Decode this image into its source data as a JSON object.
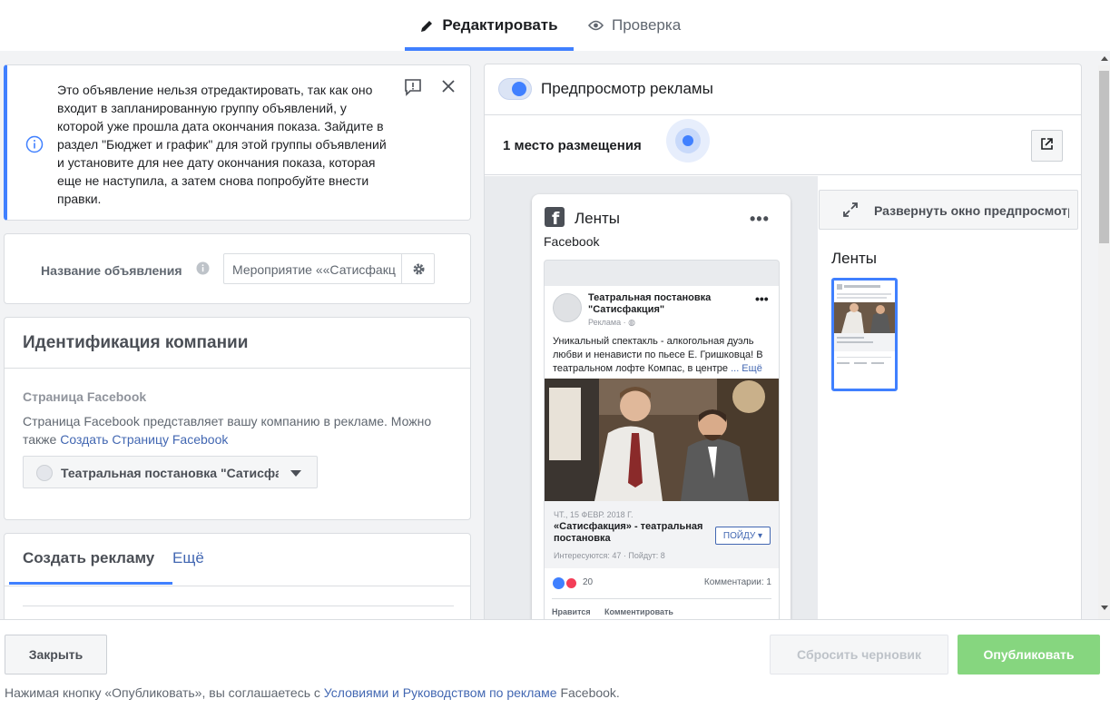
{
  "tabs": {
    "edit": "Редактировать",
    "review": "Проверка"
  },
  "alert": {
    "text": "Это объявление нельзя отредактировать, так как оно входит в запланированную группу объявлений, у которой уже прошла дата окончания показа. Зайдите в раздел \"Бюджет и график\" для этой группы объявлений и установите для нее дату окончания показа, которая еще не наступила, а затем снова попробуйте внести правки."
  },
  "ad_name": {
    "label": "Название объявления",
    "value": "Мероприятие ««Сатисфакция» - театральная постановка"
  },
  "identity": {
    "title": "Идентификация компании",
    "subtitle": "Страница Facebook",
    "description": "Страница Facebook представляет вашу компанию в рекламе. Можно также ",
    "link": "Создать Страницу Facebook",
    "page_name": "Театральная постановка \"Сатисфакция\""
  },
  "create": {
    "tab_active": "Создать рекламу",
    "tab_more": "Ещё"
  },
  "preview": {
    "toggle_label": "Предпросмотр рекламы",
    "placements": "1 место размещения",
    "expand_label": "Развернуть окно предпросмотра",
    "side_feeds": "Ленты",
    "phone": {
      "feeds": "Ленты",
      "dots": "•••",
      "source": "Facebook",
      "post_name": "Театральная постановка \"Сатисфакция\"",
      "sponsored": "Реклама · ◍",
      "post_dots": "•••",
      "post_text": "Уникальный спектакль - алкогольная дуэль любви и ненависти по пьесе Е. Гришковца! В театральном лофте Компас, в центре",
      "more": "... Ещё",
      "event_date": "ЧТ., 15 ФЕВР. 2018 Г.",
      "event_title": "«Сатисфакция» - театральная постановка",
      "event_meta": "Интересуются: 47 · Пойдут: 8",
      "event_button": "ПОЙДУ ▾",
      "reactions_count": "20",
      "comments": "Комментарии: 1",
      "action_like": "Нравится",
      "action_comment": "Комментировать"
    }
  },
  "footer": {
    "close": "Закрыть",
    "reset": "Сбросить черновик",
    "publish": "Опубликовать",
    "terms_prefix": "Нажимая кнопку «Опубликовать», вы соглашаетесь с ",
    "terms_link": "Условиями и Руководством по рекламе",
    "terms_suffix": " Facebook."
  },
  "colors": {
    "accent": "#4080ff",
    "link": "#4267b2",
    "publish": "#86d67f"
  }
}
